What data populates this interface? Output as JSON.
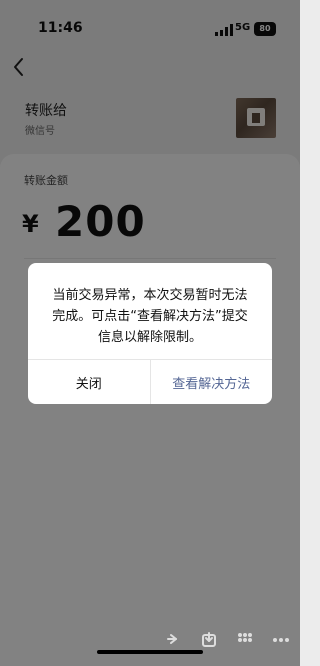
{
  "status": {
    "time": "11:46",
    "network": "5G",
    "battery": "80"
  },
  "payee": {
    "name": "转账给",
    "subtext": "微信号"
  },
  "amount": {
    "label": "转账金额",
    "currency": "¥",
    "value": "200"
  },
  "dialog": {
    "message": "当前交易异常，本次交易暂时无法\n完成。可点击“查看解决方法”提交\n信息以解除限制。",
    "cancel_label": "关闭",
    "confirm_label": "查看解决方法"
  },
  "icons": {
    "back": "chevron-left-icon",
    "share": "share-icon",
    "download": "download-icon",
    "apps": "grid-icon",
    "more": "more-icon"
  },
  "colors": {
    "overlay": "#00000080",
    "dialog_background": "#ffffff",
    "primary_text": "#111111",
    "accent": "#556795"
  }
}
